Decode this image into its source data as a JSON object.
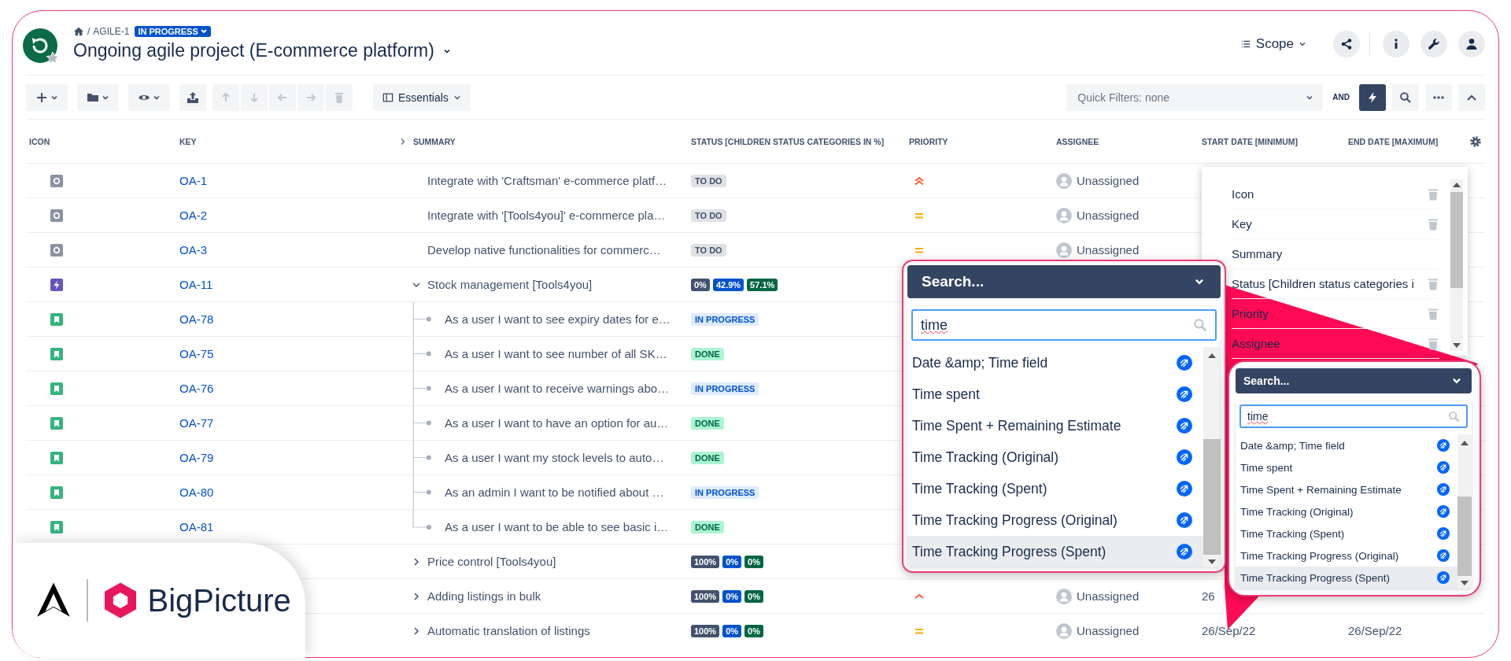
{
  "header": {
    "separator": "/",
    "project_key": "AGILE-1",
    "status": "IN PROGRESS",
    "title": "Ongoing agile project (E-commerce platform)",
    "scope_label": "Scope",
    "actions": [
      {
        "kind": "share"
      },
      {
        "kind": "info"
      },
      {
        "kind": "wrench"
      },
      {
        "kind": "user"
      }
    ]
  },
  "toolbar": {
    "buttons": [
      {
        "kind": "add",
        "menu": true,
        "disabled": false
      },
      {
        "kind": "folder",
        "menu": true,
        "disabled": false
      },
      {
        "kind": "eye",
        "menu": true,
        "disabled": false
      },
      {
        "kind": "export",
        "menu": false,
        "disabled": false
      },
      {
        "kind": "up",
        "menu": false,
        "disabled": true
      },
      {
        "kind": "down",
        "menu": false,
        "disabled": true
      },
      {
        "kind": "left",
        "menu": false,
        "disabled": true
      },
      {
        "kind": "right",
        "menu": false,
        "disabled": true
      },
      {
        "kind": "trash",
        "menu": false,
        "disabled": true
      }
    ],
    "view_label": "Essentials",
    "quick_filter": "Quick Filters: none",
    "logic": "AND",
    "tools": [
      {
        "kind": "bolt",
        "active": true
      },
      {
        "kind": "search",
        "active": false
      },
      {
        "kind": "more",
        "active": false
      },
      {
        "kind": "collapse",
        "active": false
      }
    ]
  },
  "table": {
    "columns": [
      "ICON",
      "KEY",
      "SUMMARY",
      "STATUS [CHILDREN STATUS CATEGORIES IN %]",
      "PRIORITY",
      "ASSIGNEE",
      "START DATE [MINIMUM]",
      "END DATE [MAXIMUM]"
    ],
    "rows": [
      {
        "kind": "task",
        "key": "OA-1",
        "summary": "Integrate with 'Craftsman' e-commerce platf…",
        "status": {
          "kind": "todo",
          "label": "TO DO"
        },
        "priority": {
          "kind": "highest"
        },
        "assignee": "Unassigned"
      },
      {
        "kind": "task",
        "key": "OA-2",
        "summary": "Integrate with '[Tools4you]' e-commerce pla…",
        "status": {
          "kind": "todo",
          "label": "TO DO"
        },
        "priority": {
          "kind": "medium"
        },
        "assignee": "Unassigned"
      },
      {
        "kind": "task",
        "key": "OA-3",
        "summary": "Develop native functionalities for commerc…",
        "status": {
          "kind": "todo",
          "label": "TO DO"
        },
        "priority": {
          "kind": "medium"
        },
        "assignee": "Unassigned"
      },
      {
        "kind": "epic",
        "key": "OA-11",
        "summary": "Stock management [Tools4you]",
        "expanded": true,
        "status_split": [
          {
            "kind": "todo",
            "label": "0%"
          },
          {
            "kind": "inprogress",
            "label": "42.9%"
          },
          {
            "kind": "done",
            "label": "57.1%"
          }
        ],
        "children": [
          {
            "kind": "story",
            "key": "OA-78",
            "summary": "As a user I want to see expiry dates for e…",
            "status": {
              "kind": "inprogress",
              "label": "IN PROGRESS"
            }
          },
          {
            "kind": "story",
            "key": "OA-75",
            "summary": "As a user I want to see number of all SK…",
            "status": {
              "kind": "done",
              "label": "DONE"
            }
          },
          {
            "kind": "story",
            "key": "OA-76",
            "summary": "As a user I want to receive warnings abo…",
            "status": {
              "kind": "inprogress",
              "label": "IN PROGRESS"
            }
          },
          {
            "kind": "story",
            "key": "OA-77",
            "summary": "As a user I want to have an option for au…",
            "status": {
              "kind": "done",
              "label": "DONE"
            }
          },
          {
            "kind": "story",
            "key": "OA-79",
            "summary": "As a user I want my stock levels to auto…",
            "status": {
              "kind": "done",
              "label": "DONE"
            }
          },
          {
            "kind": "story",
            "key": "OA-80",
            "summary": "As an admin I want to be notified about …",
            "status": {
              "kind": "inprogress",
              "label": "IN PROGRESS"
            }
          },
          {
            "kind": "story",
            "key": "OA-81",
            "summary": "As a user I want to be able to see basic i…",
            "status": {
              "kind": "done",
              "label": "DONE"
            }
          }
        ]
      },
      {
        "summary": "Price control [Tools4you]",
        "expanded": false,
        "status_split": [
          {
            "kind": "todo",
            "label": "100%"
          },
          {
            "kind": "inprogress",
            "label": "0%"
          },
          {
            "kind": "done",
            "label": "0%"
          }
        ]
      },
      {
        "summary": "Adding listings in bulk",
        "expanded": false,
        "status_split": [
          {
            "kind": "todo",
            "label": "100%"
          },
          {
            "kind": "inprogress",
            "label": "0%"
          },
          {
            "kind": "done",
            "label": "0%"
          }
        ],
        "priority": {
          "kind": "high"
        },
        "assignee": "Unassigned",
        "start_date": "26"
      },
      {
        "summary": "Automatic translation of listings",
        "expanded": false,
        "status_split": [
          {
            "kind": "todo",
            "label": "100%"
          },
          {
            "kind": "inprogress",
            "label": "0%"
          },
          {
            "kind": "done",
            "label": "0%"
          }
        ],
        "priority": {
          "kind": "medium"
        },
        "assignee": "Unassigned",
        "start_date": "26/Sep/22",
        "end_date": "26/Sep/22"
      }
    ]
  },
  "column_panel": {
    "items": [
      {
        "label": "Icon",
        "removable": true
      },
      {
        "label": "Key",
        "removable": true
      },
      {
        "label": "Summary",
        "removable": false
      },
      {
        "label": "Status [Children status categories i",
        "removable": true
      },
      {
        "label": "Priority",
        "removable": true
      },
      {
        "label": "Assignee",
        "removable": true
      }
    ]
  },
  "field_picker_zoomed": {
    "title": "Search...",
    "query": "time",
    "results": [
      {
        "label": "Date &amp; Time field",
        "highlighted": false
      },
      {
        "label": "Time spent",
        "highlighted": false
      },
      {
        "label": "Time Spent + Remaining Estimate",
        "highlighted": false
      },
      {
        "label": "Time Tracking (Original)",
        "highlighted": false
      },
      {
        "label": "Time Tracking (Spent)",
        "highlighted": false
      },
      {
        "label": "Time Tracking Progress (Original)",
        "highlighted": false
      },
      {
        "label": "Time Tracking Progress (Spent)",
        "highlighted": true
      }
    ]
  },
  "field_picker": {
    "title": "Search...",
    "query": "time",
    "results": [
      {
        "label": "Date &amp; Time field",
        "highlighted": false
      },
      {
        "label": "Time spent",
        "highlighted": false
      },
      {
        "label": "Time Spent + Remaining Estimate",
        "highlighted": false
      },
      {
        "label": "Time Tracking (Original)",
        "highlighted": false
      },
      {
        "label": "Time Tracking (Spent)",
        "highlighted": false
      },
      {
        "label": "Time Tracking Progress (Original)",
        "highlighted": false
      },
      {
        "label": "Time Tracking Progress (Spent)",
        "highlighted": true
      }
    ]
  },
  "brand": {
    "name": "BigPicture"
  }
}
